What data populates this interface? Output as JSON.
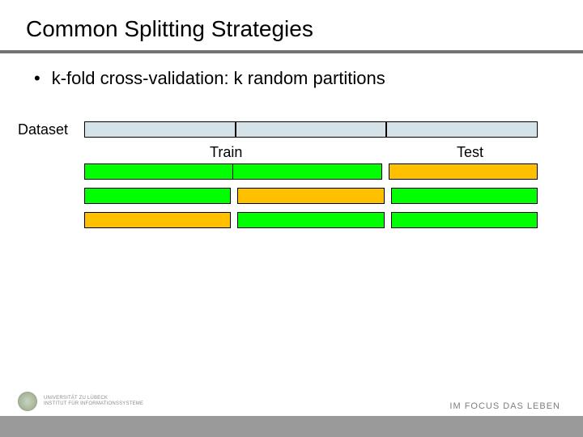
{
  "title": "Common Splitting Strategies",
  "bullet": {
    "dot": "•",
    "text": "k-fold cross-validation: k random partitions"
  },
  "labels": {
    "dataset": "Dataset",
    "train": "Train",
    "test": "Test"
  },
  "rows": [
    {
      "segments": [
        "train",
        "train",
        "test"
      ]
    },
    {
      "segments": [
        "train",
        "test",
        "train"
      ]
    },
    {
      "segments": [
        "test",
        "train",
        "train"
      ]
    }
  ],
  "footer": {
    "uni_line1": "UNIVERSITÄT ZU LÜBECK",
    "uni_line2": "INSTITUT FÜR INFORMATIONSSYSTEME",
    "motto": "IM FOCUS DAS LEBEN"
  }
}
